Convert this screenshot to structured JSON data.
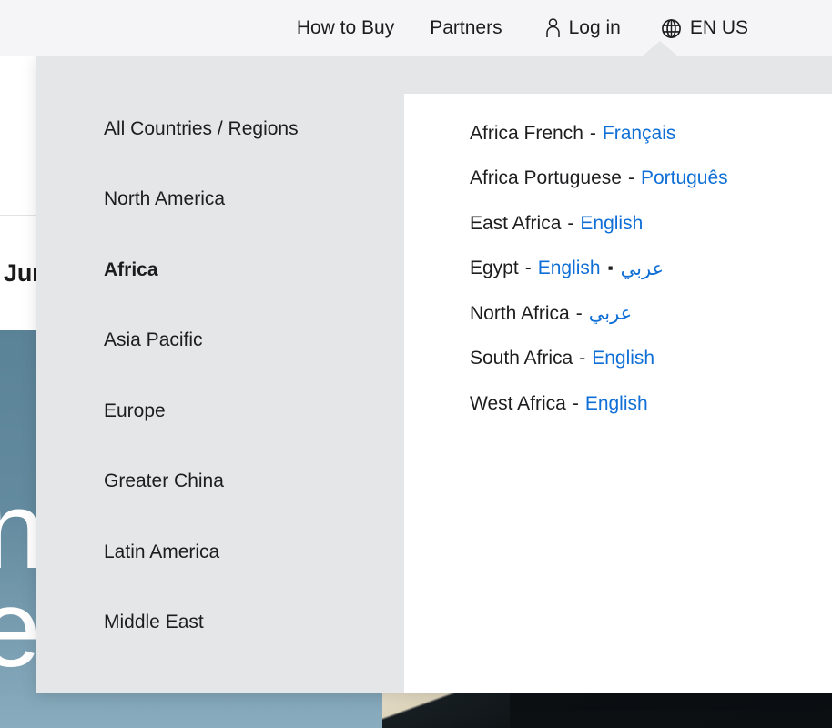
{
  "topbar": {
    "nav": [
      {
        "label": "How to Buy",
        "name": "how-to-buy"
      },
      {
        "label": "Partners",
        "name": "partners"
      }
    ],
    "login_label": "Log in",
    "login_icon": "person-icon",
    "locale_label": "EN US",
    "locale_icon": "globe-icon",
    "background_color": "#f5f5f7"
  },
  "background": {
    "banner_text": "Jun",
    "hero_line1": "n",
    "hero_line2": "et",
    "hero_color": "#5b8398"
  },
  "dropdown": {
    "panel_bg": "#e5e6e8",
    "panel_right_bg": "#ffffff",
    "link_color": "#0f6fd6",
    "regions": [
      {
        "label": "All Countries / Regions",
        "name": "all-countries-regions",
        "selected": false
      },
      {
        "label": "North America",
        "name": "north-america",
        "selected": false
      },
      {
        "label": "Africa",
        "name": "africa",
        "selected": true
      },
      {
        "label": "Asia Pacific",
        "name": "asia-pacific",
        "selected": false
      },
      {
        "label": "Europe",
        "name": "europe",
        "selected": false
      },
      {
        "label": "Greater China",
        "name": "greater-china",
        "selected": false
      },
      {
        "label": "Latin America",
        "name": "latin-america",
        "selected": false
      },
      {
        "label": "Middle East",
        "name": "middle-east",
        "selected": false
      }
    ],
    "countries": [
      {
        "name": "Africa French",
        "dash": "-",
        "languages": [
          "Français"
        ]
      },
      {
        "name": "Africa Portuguese",
        "dash": "-",
        "languages": [
          "Português"
        ]
      },
      {
        "name": "East Africa",
        "dash": "-",
        "languages": [
          "English"
        ]
      },
      {
        "name": "Egypt",
        "dash": "-",
        "languages": [
          "English",
          "عربي"
        ],
        "separator": "▪"
      },
      {
        "name": "North Africa",
        "dash": "-",
        "languages": [
          "عربي"
        ]
      },
      {
        "name": "South Africa",
        "dash": "-",
        "languages": [
          "English"
        ]
      },
      {
        "name": "West Africa",
        "dash": "-",
        "languages": [
          "English"
        ]
      }
    ]
  }
}
